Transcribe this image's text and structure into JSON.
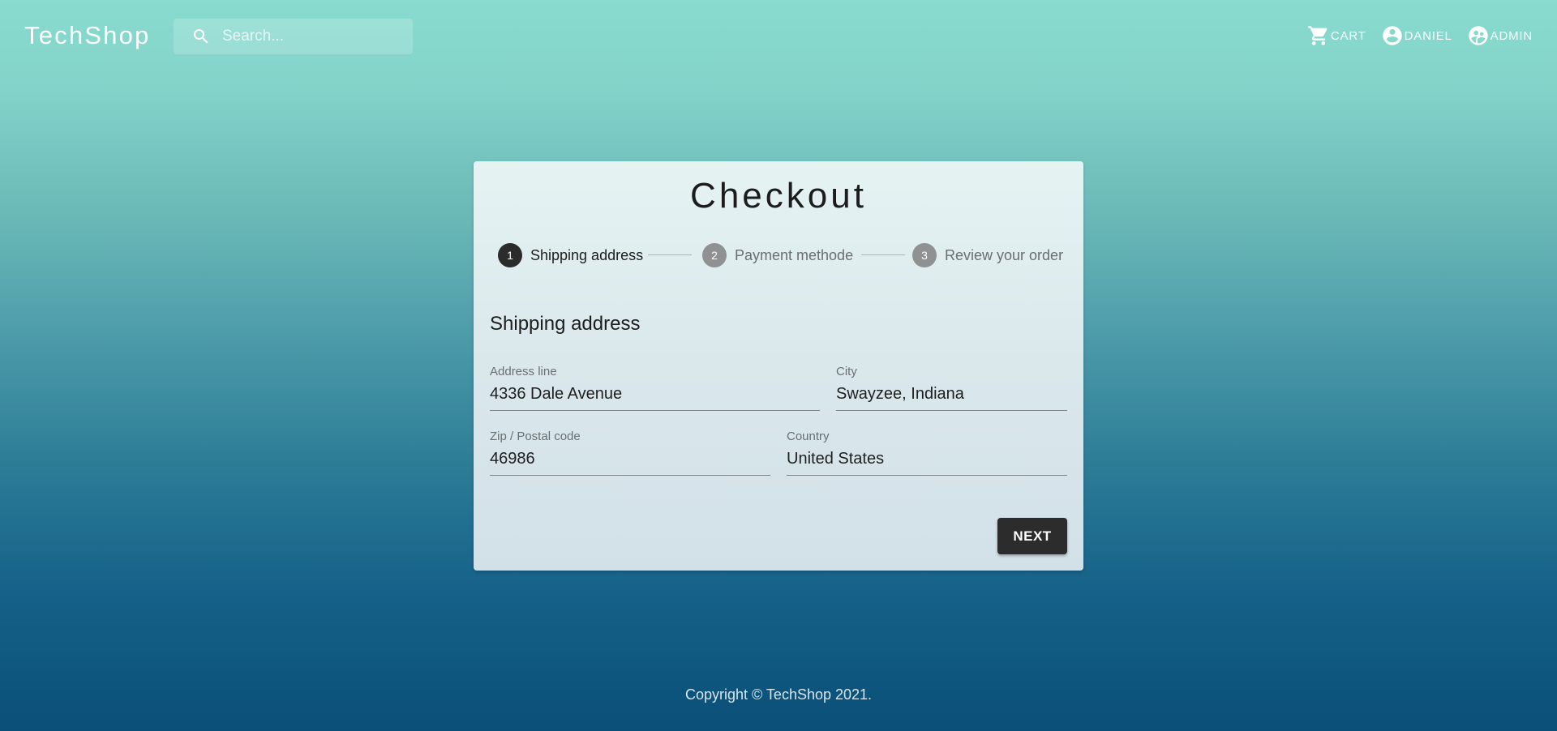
{
  "header": {
    "logo": "TechShop",
    "search_placeholder": "Search...",
    "nav": {
      "cart": "CART",
      "user": "DANIEL",
      "admin": "ADMIN"
    }
  },
  "checkout": {
    "title": "Checkout",
    "steps": [
      {
        "number": "1",
        "label": "Shipping address",
        "state": "active"
      },
      {
        "number": "2",
        "label": "Payment methode",
        "state": "inactive"
      },
      {
        "number": "3",
        "label": "Review your order",
        "state": "inactive"
      }
    ],
    "section_title": "Shipping address",
    "fields": {
      "address": {
        "label": "Address line",
        "value": "4336 Dale Avenue"
      },
      "city": {
        "label": "City",
        "value": "Swayzee, Indiana"
      },
      "zip": {
        "label": "Zip / Postal code",
        "value": "46986"
      },
      "country": {
        "label": "Country",
        "value": "United States"
      }
    },
    "next_label": "NEXT"
  },
  "footer": {
    "copyright": "Copyright © TechShop 2021."
  },
  "colors": {
    "accent_dark": "#2c2c2c",
    "step_inactive": "#8f9192",
    "bg_top": "#88dbcf",
    "bg_bottom": "#0a4f77"
  }
}
